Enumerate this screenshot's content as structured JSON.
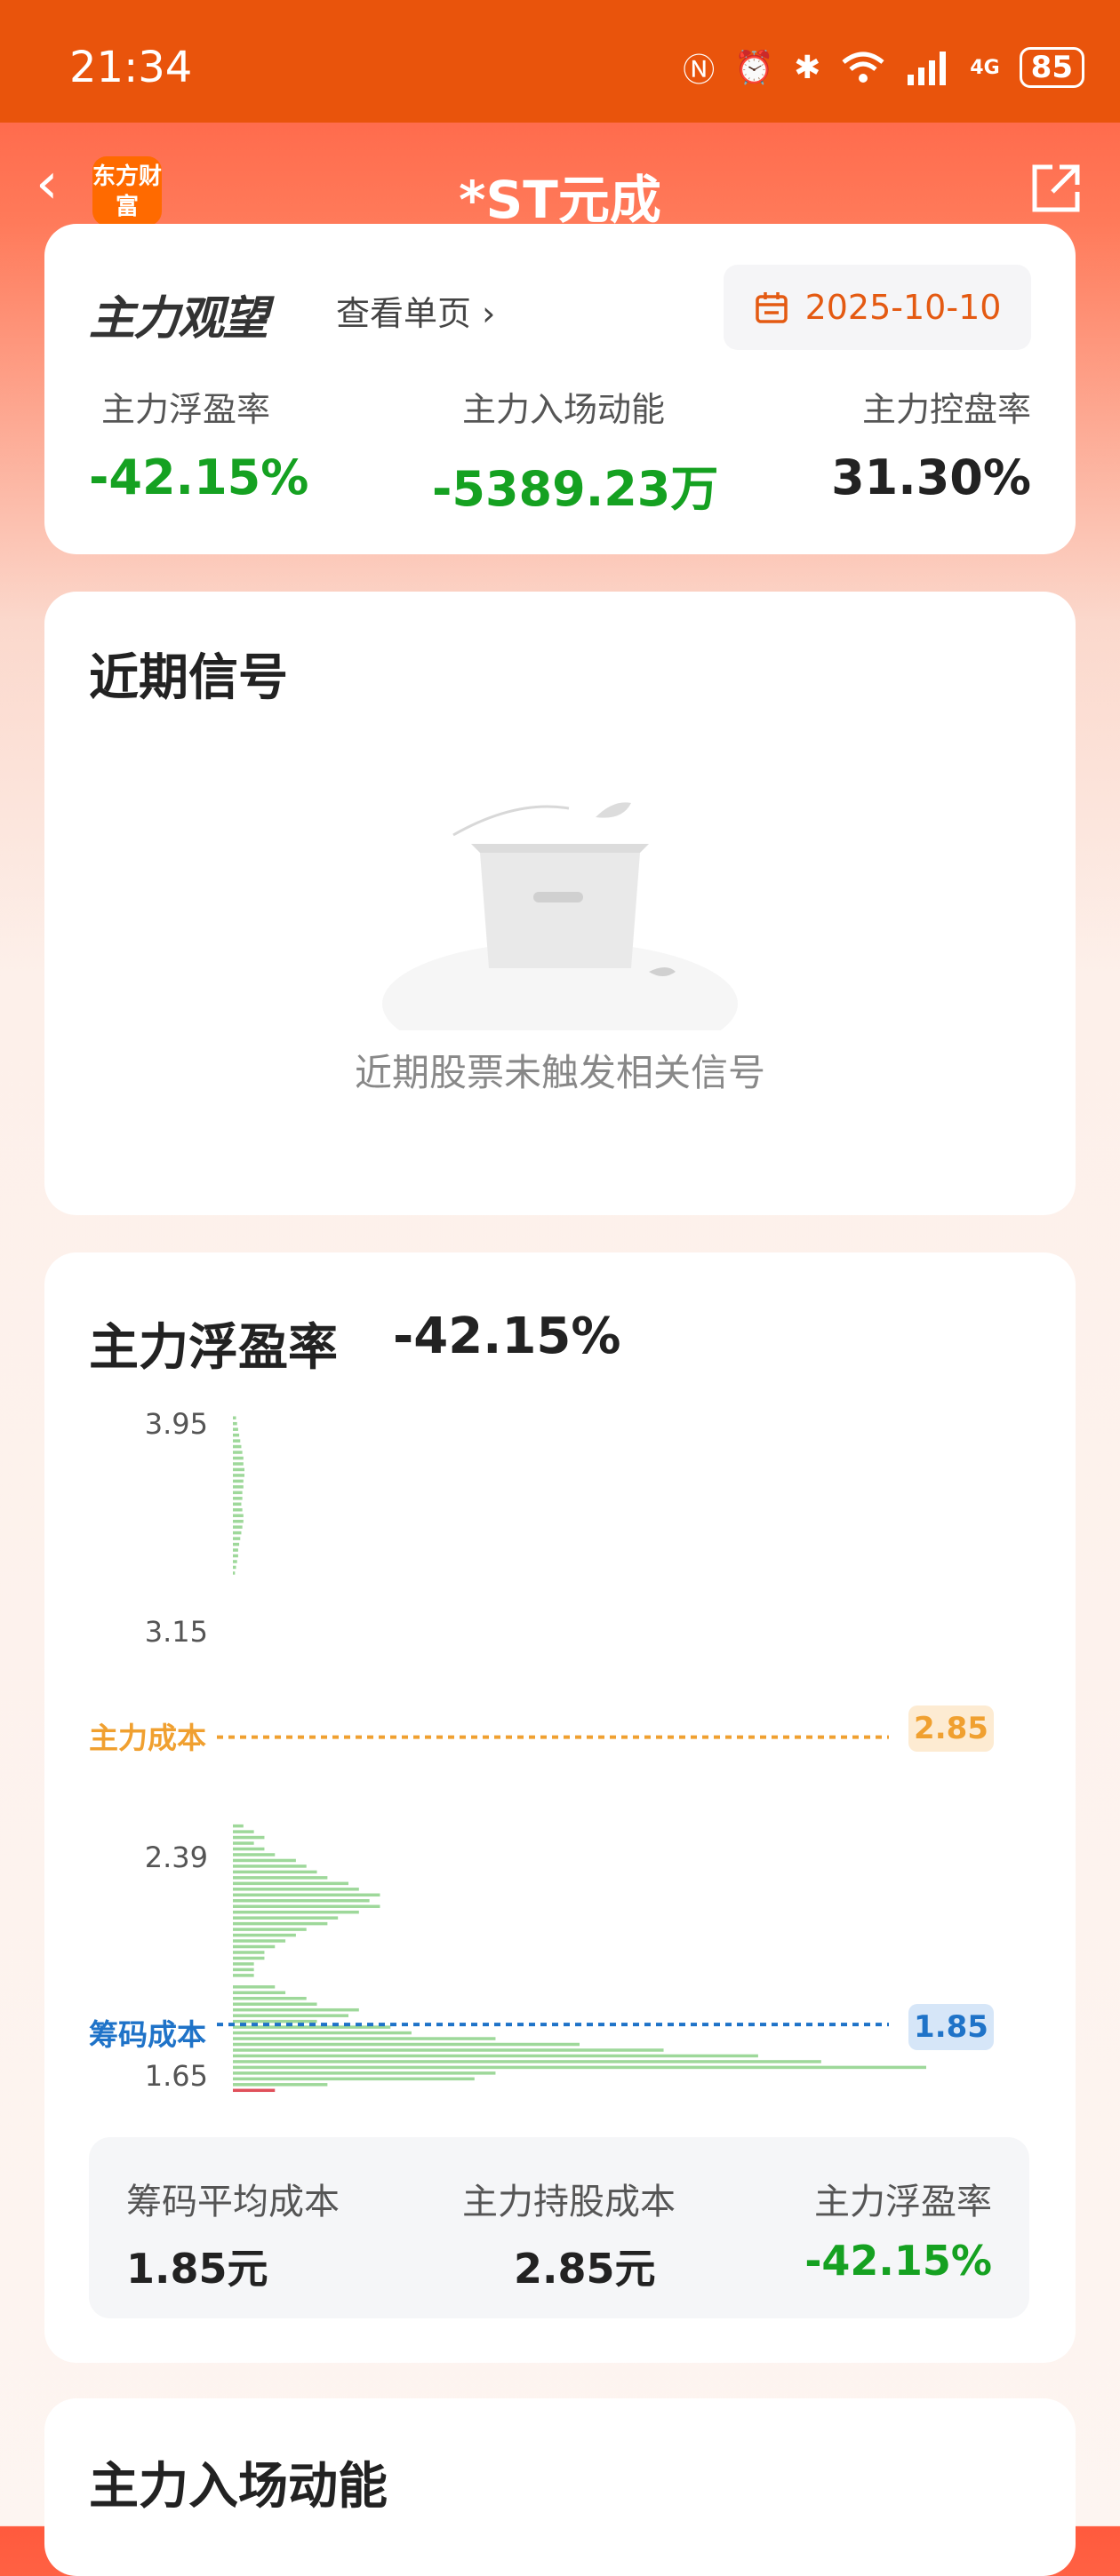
{
  "status": {
    "time": "21:34",
    "battery": "85",
    "network": "4G"
  },
  "nav": {
    "title": "*ST元成",
    "logo_text": "东方财富"
  },
  "overview": {
    "brand": "主力观望",
    "view_page": "查看单页",
    "date": "2025-10-10",
    "metrics": [
      {
        "label": "主力浮盈率",
        "value": "-42.15%"
      },
      {
        "label": "主力入场动能",
        "value": "-5389.23万"
      },
      {
        "label": "主力控盘率",
        "value": "31.30%"
      }
    ]
  },
  "signals": {
    "title": "近期信号",
    "empty_text": "近期股票未触发相关信号"
  },
  "profit": {
    "title": "主力浮盈率",
    "title_value": "-42.15%",
    "main_cost_label": "主力成本",
    "main_cost_value": "2.85",
    "chip_cost_label": "筹码成本",
    "chip_cost_value": "1.85",
    "summary": [
      {
        "label": "筹码平均成本",
        "value": "1.85元"
      },
      {
        "label": "主力持股成本",
        "value": "2.85元"
      },
      {
        "label": "主力浮盈率",
        "value": "-42.15%"
      }
    ]
  },
  "inflow": {
    "title": "主力入场动能"
  },
  "colors": {
    "accent": "#e9540c",
    "green": "#15a121",
    "orange": "#f0a030",
    "blue": "#1f73c8",
    "red": "#e0505a"
  },
  "chart_data": {
    "type": "bar",
    "orientation": "horizontal",
    "y_ticks": [
      "3.95",
      "3.15",
      "2.39",
      "1.65"
    ],
    "ylim": [
      1.6,
      3.98
    ],
    "reference_lines": [
      {
        "name": "主力成本",
        "value": 2.85
      },
      {
        "name": "筹码成本",
        "value": 1.85
      }
    ],
    "series": [
      {
        "color": "#9ed89a",
        "prices": [
          3.96,
          3.94,
          3.92,
          3.9,
          3.88,
          3.86,
          3.84,
          3.82,
          3.8,
          3.78,
          3.76,
          3.74,
          3.72,
          3.7,
          3.68,
          3.66,
          3.64,
          3.62,
          3.6,
          3.58,
          3.56,
          3.54,
          3.52,
          3.5,
          3.48,
          3.46,
          3.44,
          3.42,
          2.54,
          2.52,
          2.5,
          2.48,
          2.46,
          2.44,
          2.42,
          2.4,
          2.38,
          2.36,
          2.34,
          2.32,
          2.3,
          2.28,
          2.26,
          2.24,
          2.22,
          2.2,
          2.18,
          2.16,
          2.14,
          2.12,
          2.1,
          2.08,
          2.06,
          2.04,
          2.02,
          1.98,
          1.96,
          1.94,
          1.92,
          1.9,
          1.88,
          1.86,
          1.84,
          1.82,
          1.8,
          1.78,
          1.76,
          1.74,
          1.72,
          1.7,
          1.68,
          1.66,
          1.64
        ],
        "values": [
          0.3,
          0.4,
          0.5,
          0.6,
          0.7,
          0.8,
          0.9,
          1.0,
          1.0,
          1.1,
          1.1,
          1.0,
          1.0,
          0.9,
          0.9,
          0.8,
          0.9,
          1.0,
          1.0,
          0.9,
          0.8,
          0.7,
          0.6,
          0.5,
          0.5,
          0.4,
          0.3,
          0.2,
          1.0,
          2.0,
          3.0,
          2.0,
          3.0,
          4.0,
          6.0,
          7.0,
          8.0,
          9.0,
          11.0,
          12.0,
          14.0,
          13.0,
          14.0,
          12.0,
          10.0,
          9.0,
          7.0,
          6.0,
          5.0,
          4.0,
          3.0,
          3.0,
          2.0,
          2.0,
          2.0,
          4.0,
          5.0,
          7.0,
          8.0,
          12.0,
          11.0,
          8.0,
          15.0,
          17.0,
          25.0,
          33.0,
          41.0,
          50.0,
          56.0,
          66.0,
          25.0,
          23.0,
          9.0
        ]
      },
      {
        "color": "#e0505a",
        "prices": [
          1.62
        ],
        "values": [
          4.0
        ]
      }
    ]
  }
}
